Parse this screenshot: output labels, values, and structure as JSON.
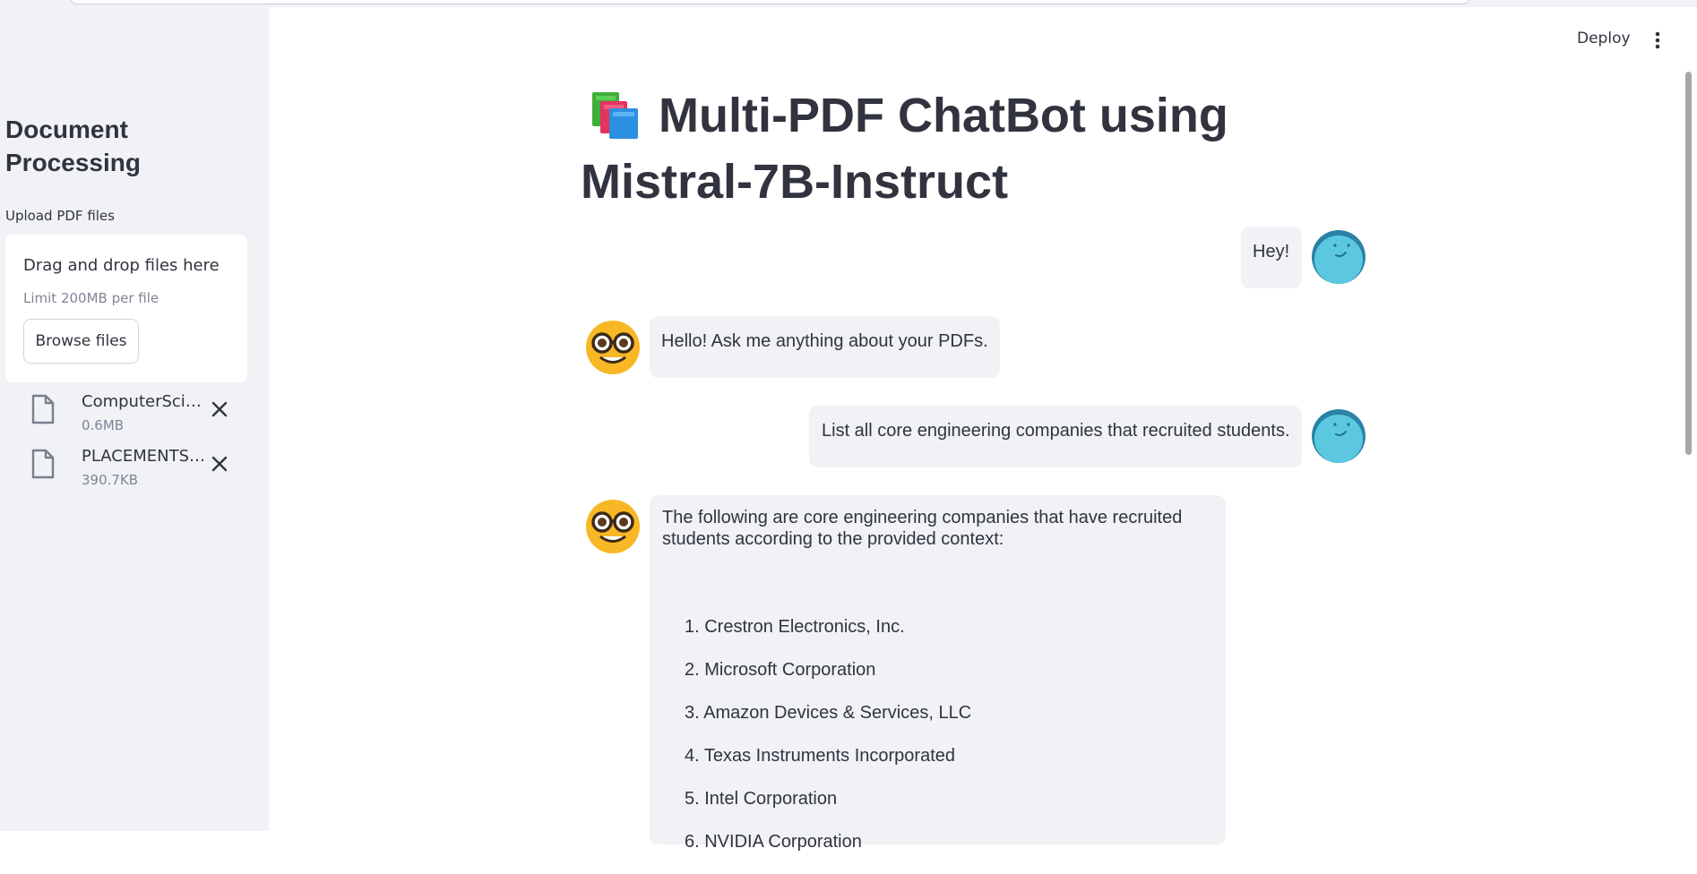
{
  "sidebar": {
    "title": "Document Processing",
    "upload_label": "Upload PDF files",
    "dropzone": {
      "title": "Drag and drop files here",
      "limit": "Limit 200MB per file",
      "browse_label": "Browse files"
    },
    "files": [
      {
        "name": "ComputerScience.pdf",
        "size": "0.6MB",
        "icon": "file-icon"
      },
      {
        "name": "PLACEMENTS-2023.pdf",
        "size": "390.7KB",
        "icon": "file-icon"
      }
    ]
  },
  "header": {
    "deploy_label": "Deploy",
    "menu_icon": "vertical-ellipsis-icon"
  },
  "main": {
    "title_icon": "books-icon",
    "title": "Multi-PDF ChatBot using Mistral-7B-Instruct",
    "messages": [
      {
        "role": "user",
        "avatar": "smiley-avatar-icon",
        "text": "Hey!"
      },
      {
        "role": "assistant",
        "avatar": "nerd-face-avatar-icon",
        "text": "Hello! Ask me anything about your PDFs."
      },
      {
        "role": "user",
        "avatar": "smiley-avatar-icon",
        "text": "List all core engineering companies that recruited students."
      },
      {
        "role": "assistant",
        "avatar": "nerd-face-avatar-icon",
        "intro": "The following are core engineering companies that have recruited students according to the provided context:",
        "list": [
          "1. Crestron Electronics, Inc.",
          "2. Microsoft Corporation",
          "3. Amazon Devices & Services, LLC",
          "4. Texas Instruments Incorporated",
          "5. Intel Corporation",
          "6. NVIDIA Corporation"
        ]
      }
    ]
  },
  "colors": {
    "sidebar_bg": "#f0f2f6",
    "bubble_bg": "#f0f2f6",
    "text": "#31333F",
    "muted": "#808495",
    "user_avatar": "#5bc8e0",
    "assistant_avatar": "#f8b725"
  }
}
